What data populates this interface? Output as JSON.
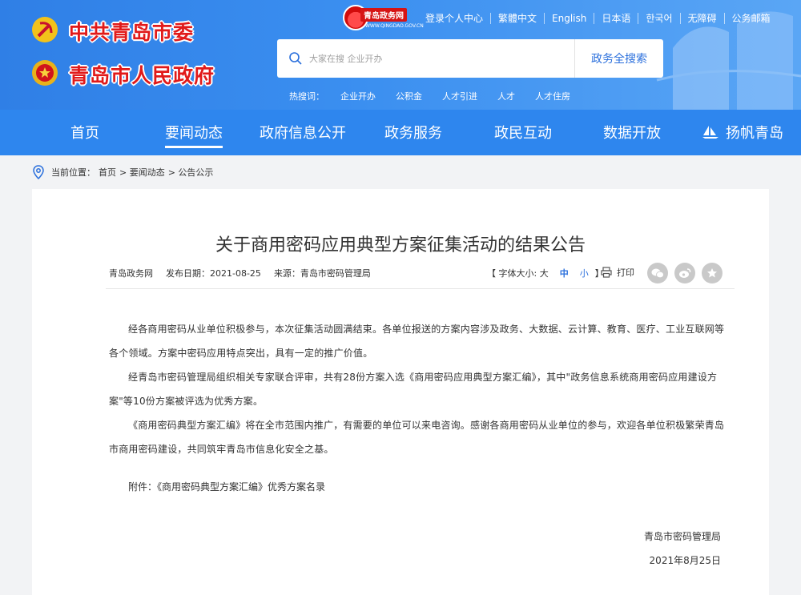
{
  "header": {
    "party_committee": "中共青岛市委",
    "government": "青岛市人民政府",
    "portal_logo_text": "青岛政务网",
    "portal_domain": "WWW.QINGDAO.GOV.CN",
    "top_links": [
      "登录个人中心",
      "繁體中文",
      "English",
      "日本语",
      "한국어",
      "无障碍",
      "公务邮箱"
    ],
    "search_placeholder": "大家在搜 企业开办",
    "search_button": "政务全搜索",
    "hotwords_label": "热搜词：",
    "hotwords": [
      "企业开办",
      "公积金",
      "人才引进",
      "人才",
      "人才住房"
    ]
  },
  "nav": {
    "items": [
      "首页",
      "要闻动态",
      "政府信息公开",
      "政务服务",
      "政民互动",
      "数据开放",
      "扬帆青岛"
    ],
    "active": "要闻动态"
  },
  "breadcrumb": {
    "label": "当前位置：",
    "items": [
      "首页",
      "> 要闻动态",
      "> 公告公示"
    ]
  },
  "article": {
    "title": "关于商用密码应用典型方案征集活动的结果公告",
    "source_site": "青岛政务网",
    "publish_date": "发布日期：2021-08-25",
    "source": "来源：青岛市密码管理局",
    "font_size_label": "【 字体大小: 大",
    "font_mid": "中",
    "font_small": "小",
    "font_close": "】",
    "print_label": "打印",
    "paragraphs": [
      "经各商用密码从业单位积极参与，本次征集活动圆满结束。各单位报送的方案内容涉及政务、大数据、云计算、教育、医疗、工业互联网等各个领域。方案中密码应用特点突出，具有一定的推广价值。",
      "经青岛市密码管理局组织相关专家联合评审，共有28份方案入选《商用密码应用典型方案汇编》，其中\"政务信息系统商用密码应用建设方案\"等10份方案被评选为优秀方案。",
      "《商用密码典型方案汇编》将在全市范围内推广，有需要的单位可以来电咨询。感谢各商用密码从业单位的参与，欢迎各单位积极繁荣青岛市商用密码建设，共同筑牢青岛市信息化安全之基。"
    ],
    "attachment": "附件：《商用密码典型方案汇编》优秀方案名录",
    "signature_org": "青岛市密码管理局",
    "signature_date": "2021年8月25日"
  }
}
